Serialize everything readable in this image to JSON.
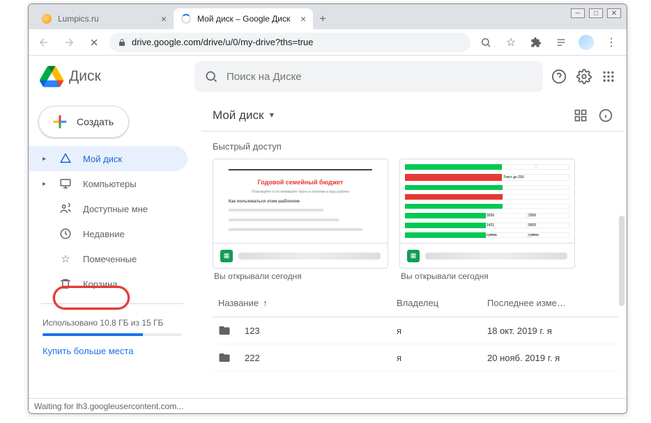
{
  "window": {
    "tabs": [
      {
        "title": "Lumpics.ru",
        "active": false
      },
      {
        "title": "Мой диск – Google Диск",
        "active": true
      }
    ],
    "url_display": "drive.google.com/drive/u/0/my-drive?ths=true",
    "status_text": "Waiting for lh3.googleusercontent.com..."
  },
  "app": {
    "logo_text": "Диск",
    "search_placeholder": "Поиск на Диске"
  },
  "sidebar": {
    "create_label": "Создать",
    "items": [
      {
        "id": "my-drive",
        "label": "Мой диск",
        "expandable": true,
        "active": true
      },
      {
        "id": "computers",
        "label": "Компьютеры",
        "expandable": true
      },
      {
        "id": "shared",
        "label": "Доступные мне"
      },
      {
        "id": "recent",
        "label": "Недавние"
      },
      {
        "id": "starred",
        "label": "Помеченные"
      },
      {
        "id": "trash",
        "label": "Корзина"
      }
    ],
    "storage_text": "Использовано 10,8 ГБ из 15 ГБ",
    "buy_more": "Купить больше места"
  },
  "main": {
    "breadcrumb": "Мой диск",
    "quick_access_title": "Быстрый доступ",
    "cards": [
      {
        "preview_title": "Годовой семейный бюджет",
        "subtitle": "Вы открывали сегодня"
      },
      {
        "preview_title": "",
        "subtitle": "Вы открывали сегодня"
      }
    ],
    "columns": {
      "name": "Название",
      "owner": "Владелец",
      "modified": "Последнее изме…"
    },
    "rows": [
      {
        "name": "123",
        "owner": "я",
        "modified": "18 окт. 2019 г. я"
      },
      {
        "name": "222",
        "owner": "я",
        "modified": "20 нояб. 2019 г. я"
      }
    ]
  }
}
